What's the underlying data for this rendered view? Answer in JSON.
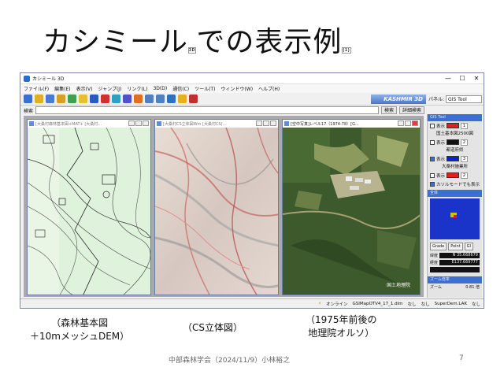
{
  "slide": {
    "title_part1": "カシミール",
    "title_num": "3D",
    "title_part2": "での表示例",
    "title_num2": "(1)",
    "captions": [
      {
        "line1": "（森林基本図",
        "line2": "＋10mメッシュDEM）"
      },
      {
        "line1": "（CS立体図）",
        "line2": ""
      },
      {
        "line1": "（1975年前後の",
        "line2": "地理院オルソ）"
      }
    ],
    "footer": "中部森林学会（2024/11/9）小林裕之",
    "page_number": "7"
  },
  "app": {
    "title": "カシミール 3D",
    "window_buttons": [
      "—",
      "☐",
      "✕"
    ],
    "menu": [
      "ファイル(F)",
      "編集(E)",
      "表示(V)",
      "ジャンプ(J)",
      "リンク(L)",
      "3D(D)",
      "通信(C)",
      "ツール(T)",
      "ウィンドウ(W)",
      "ヘルプ(H)"
    ],
    "brand": "KASHMIR 3D",
    "panel_label": "パネル:",
    "panel_select": "GIS Tool",
    "search_label": "検索",
    "search_buttons": [
      "検索",
      "詳細検索"
    ],
    "children": [
      {
        "title": "[大桑村森林基本図+MAT+ [大桑村..."
      },
      {
        "title": "[大桑村CS立体図Wm [大桑村CS(..."
      },
      {
        "title": "[空中写真]レベル17（1974-78）[G..."
      }
    ],
    "ortho_label": "国土地理院",
    "side_panel": {
      "header": "GIS Tool",
      "layer1_label": "表示",
      "layer1_num": "1",
      "group1": "国土基本図2500図",
      "layer2_label": "表示",
      "layer2_num": "2",
      "group2": "都道府県",
      "layer3_label": "表示",
      "layer3_num": "3",
      "group3": "大桑村施業所",
      "layer4_label": "表示",
      "layer4_num": "2",
      "cursor_option": "カソルモードでも表示",
      "minimap_header": "全体",
      "minimap_buttons": [
        "Grade",
        "Point",
        "GI"
      ],
      "lat_label": "緯度",
      "lat_value": "N 35.668679",
      "lon_label": "経度",
      "lon_value": "E137.669777",
      "zoom_header": "ズーム倍率",
      "zoom_label": "ズーム",
      "zoom_value": "0.81 倍"
    },
    "status": {
      "online": "オンライン",
      "items": [
        "GSIMapOTV4_17_1.dim",
        "なし",
        "なし",
        "SuperDem.LAK",
        "なし"
      ]
    }
  }
}
